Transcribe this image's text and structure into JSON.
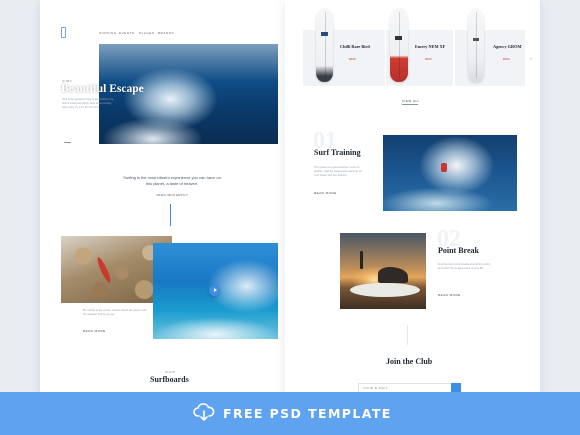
{
  "banner": {
    "text": "FREE PSD TEMPLATE",
    "icon": "cloud-download-icon",
    "background": "#5fa2f0"
  },
  "left_page": {
    "nav": [
      "SURFING",
      "EVENTS",
      "PLACES",
      "BRANDS"
    ],
    "hero": {
      "eyebrow": "SURF",
      "title": "Beautiful Escape",
      "text": "This is the greatest thing in the world to me, that is what everybody says about surfing when they try it for the first time."
    },
    "quote": {
      "text": "Surfing is the most blissful experience you can have on this planet, a taste of heaven.",
      "link": "JOHN MCCARTHY"
    },
    "gallery": {
      "text": "Be careful at the ocean, always check the waves and the weather before you go.",
      "link": "READ MORE"
    },
    "section": {
      "eyebrow": "SHOP",
      "title": "Surfboards"
    }
  },
  "right_page": {
    "boards": [
      {
        "name": "Chilli Rare Bird",
        "price": "$699",
        "color": "#2b4a7d"
      },
      {
        "name": "Emery NEM XF",
        "price": "$659",
        "color": "#d23b35"
      },
      {
        "name": "Agency GROM",
        "price": "$599",
        "color": "#d9dde2"
      }
    ],
    "view_all": "VIEW ALL",
    "training": {
      "number": "01",
      "title": "Surf Training",
      "text": "The ocean is a great teacher. Learn to paddle, read the waves and stand up on your board with our trainers.",
      "link": "READ MORE"
    },
    "point_break": {
      "number": "02",
      "title": "Point Break",
      "text": "Find the best point breaks around the world and catch the longest rides of your life.",
      "link": "READ MORE"
    },
    "club": {
      "title": "Join the Club",
      "placeholder": "YOUR E-MAIL"
    }
  }
}
